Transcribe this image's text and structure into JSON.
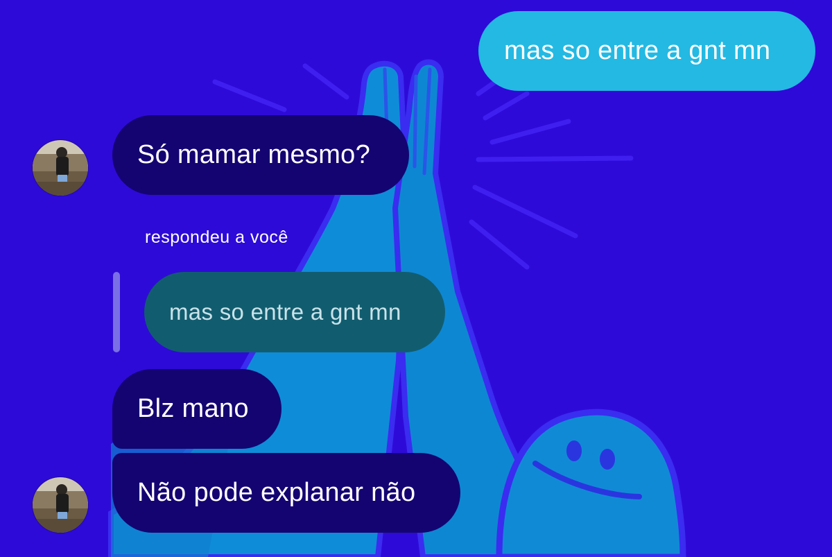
{
  "theme": {
    "background": "#2e0ad8",
    "art_color": "#0f8cd8",
    "art_line_color": "#3f1ff0"
  },
  "colors": {
    "sent_bubble": "#23b9e3",
    "received_bubble": "#140472",
    "reply_quote_bubble": "#115d6f"
  },
  "messages": {
    "sent_1": "mas so entre a gnt mn",
    "received_1": "Só mamar mesmo?",
    "reply_label": "respondeu a você",
    "reply_quote": "mas so entre a gnt mn",
    "received_2": "Blz mano",
    "received_3": "Não pode explanar não"
  }
}
